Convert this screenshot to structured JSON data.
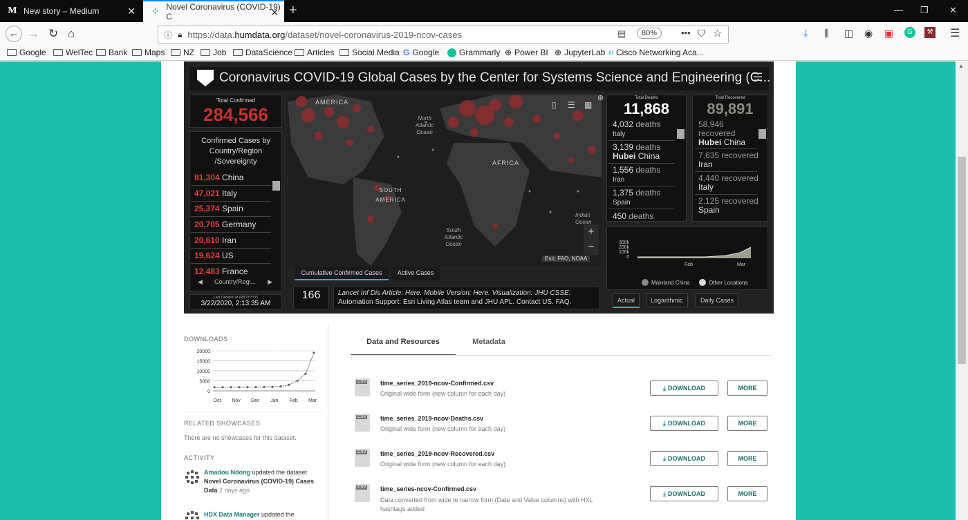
{
  "tabs": [
    {
      "icon": "M",
      "title": "New story – Medium"
    },
    {
      "title": "Novel Coronavirus (COVID-19) C"
    }
  ],
  "nav": {
    "url_prefix": "https://data.",
    "url_domain": "humdata.org",
    "url_path": "/dataset/novel-coronavirus-2019-ncov-cases",
    "zoom": "80%"
  },
  "bookmarks": [
    "Google",
    "WelTec",
    "Bank",
    "Maps",
    "NZ",
    "Job",
    "DataScience",
    "Articles",
    "Social Media",
    "Google",
    "Grammarly",
    "Power BI",
    "JupyterLab",
    "Cisco Networking Aca..."
  ],
  "dashboard": {
    "title": "Coronavirus COVID-19 Global Cases by the Center for Systems Science and Engineering (C...",
    "total_confirmed_label": "Total Confirmed",
    "total_confirmed": "284,566",
    "country_header": "Confirmed Cases by Country/Region /Sovereignty",
    "countries": [
      {
        "value": "81,304",
        "name": "China"
      },
      {
        "value": "47,021",
        "name": "Italy"
      },
      {
        "value": "25,374",
        "name": "Spain"
      },
      {
        "value": "20,705",
        "name": "Germany"
      },
      {
        "value": "20,610",
        "name": "Iran"
      },
      {
        "value": "19,624",
        "name": "US"
      },
      {
        "value": "12,483",
        "name": "France"
      }
    ],
    "country_nav_label": "Country/Regi...",
    "last_updated_label": "Last Updated at (M/D/YYYY)",
    "last_updated": "3/22/2020, 2:13:35 AM",
    "map_labels": {
      "america": "AMERICA",
      "north_atlantic": "North Atlantic Ocean",
      "africa": "AFRICA",
      "south_america": "SOUTH AMERICA",
      "south_atlantic": "South Atlantic Ocean",
      "indian_ocean": "Indian Ocean",
      "attribution": "Esri, FAO, NOAA"
    },
    "map_tabs": [
      "Cumulative Confirmed Cases",
      "Active Cases"
    ],
    "countries_count": "166",
    "info_line1": "Lancet Inf Dis Article: Here. Mobile Version: Here. Visualization: JHU CSSE.",
    "info_line2": "Automation Support: Esri Living Atlas team and JHU APL. Contact US. FAQ.",
    "deaths_label": "Total Deaths",
    "total_deaths": "11,868",
    "deaths": [
      {
        "value": "4,032",
        "unit": "deaths",
        "place": "Italy"
      },
      {
        "value": "3,139",
        "unit": "deaths",
        "place_bold": "Hubei",
        "place": "China"
      },
      {
        "value": "1,556",
        "unit": "deaths",
        "place": "Iran"
      },
      {
        "value": "1,375",
        "unit": "deaths",
        "place": "Spain"
      },
      {
        "value": "450",
        "unit": "deaths",
        "place": ""
      }
    ],
    "recovered_label": "Total Recovered",
    "total_recovered": "89,891",
    "recovered": [
      {
        "value": "58,946",
        "unit": "recovered",
        "place_bold": "Hubei",
        "place": "China"
      },
      {
        "value": "7,635",
        "unit": "recovered",
        "place": "Iran"
      },
      {
        "value": "4,440",
        "unit": "recovered",
        "place": "Italy"
      },
      {
        "value": "2,125",
        "unit": "recovered",
        "place": "Spain"
      }
    ],
    "mini_chart": {
      "yticks": [
        "300k",
        "200k",
        "100k",
        "0"
      ],
      "xticks": [
        "Feb",
        "Mar"
      ],
      "legend": [
        "Mainland China",
        "Other Locations"
      ]
    },
    "chart_tabs": [
      "Actual",
      "Logarithmic",
      "Daily Cases"
    ]
  },
  "sidebar": {
    "downloads_label": "DOWNLOADS",
    "related_label": "RELATED SHOWCASES",
    "related_text": "There are no showcases for this dataset.",
    "activity_label": "ACTIVITY",
    "activity1_user": "Amadou Ndong",
    "activity1_text": "updated the dataset",
    "activity1_dataset": "Novel Coronavirus (COVID-19) Cases Data",
    "activity1_time": "2 days ago",
    "activity2_user": "HDX Data Manager",
    "activity2_text": "updated the"
  },
  "chart_data": {
    "type": "line",
    "title": "",
    "xlabel": "",
    "ylabel": "",
    "categories": [
      "Oct",
      "Nov",
      "Dec",
      "Jan",
      "Feb",
      "Mar"
    ],
    "x": [
      "Oct",
      "Oct",
      "Nov",
      "Nov",
      "Dec",
      "Dec",
      "Jan",
      "Jan",
      "Feb",
      "Feb",
      "Mar",
      "Mar",
      "Mar"
    ],
    "values": [
      1800,
      1800,
      1800,
      1800,
      1850,
      1900,
      1950,
      2000,
      2200,
      3000,
      5000,
      8500,
      19000
    ],
    "ylim": [
      0,
      20000
    ],
    "yticks": [
      20000,
      15000,
      10000,
      5000,
      0
    ],
    "grid": true
  },
  "resources": {
    "tabs": [
      "Data and Resources",
      "Metadata"
    ],
    "download_label": "DOWNLOAD",
    "more_label": "MORE",
    "items": [
      {
        "name": "time_series_2019-ncov-Confirmed.csv",
        "desc": "Original wide form (new column for each day)"
      },
      {
        "name": "time_series_2019-ncov-Deaths.csv",
        "desc": "Original wide form (new column for each day)"
      },
      {
        "name": "time_series_2019-ncov-Recovered.csv",
        "desc": "Original wide form (new column for each day)"
      },
      {
        "name": "time_series-ncov-Confirmed.csv",
        "desc": "Data converted from wide to narrow form (Date and Value columns) with HXL hashtags added"
      }
    ]
  }
}
